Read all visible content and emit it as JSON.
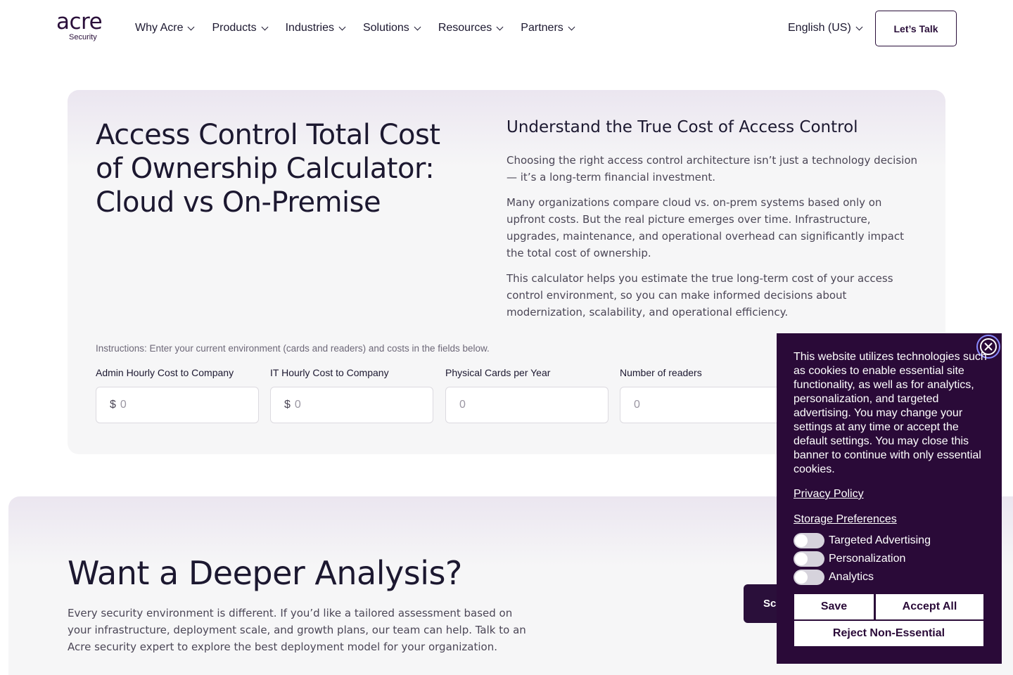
{
  "header": {
    "logo": {
      "word": "acre",
      "sub": "Security"
    },
    "nav": [
      {
        "label": "Why Acre"
      },
      {
        "label": "Products"
      },
      {
        "label": "Industries"
      },
      {
        "label": "Solutions"
      },
      {
        "label": "Resources"
      },
      {
        "label": "Partners"
      }
    ],
    "language": "English (US)",
    "cta": "Let’s Talk"
  },
  "calculator": {
    "title": "Access Control Total Cost of Ownership Calculator: Cloud vs On-Premise",
    "intro_heading": "Understand the True Cost of Access Control",
    "paragraphs": [
      "Choosing the right access control architecture isn’t just a technology decision — it’s a long-term financial investment.",
      "Many organizations compare cloud vs. on-prem systems based only on upfront costs. But the real picture emerges over time. Infrastructure, upgrades, maintenance, and operational overhead can significantly impact the total cost of ownership.",
      "This calculator helps you estimate the true long-term cost of your access control environment, so you can make informed decisions about modernization, scalability, and operational efficiency."
    ],
    "instructions": "Instructions: Enter your current environment (cards and readers) and costs in the fields below.",
    "fields": [
      {
        "label": "Admin Hourly Cost to Company",
        "prefix": "$",
        "placeholder": "0"
      },
      {
        "label": "IT Hourly Cost to Company",
        "prefix": "$",
        "placeholder": "0"
      },
      {
        "label": "Physical Cards per Year",
        "prefix": "",
        "placeholder": "0"
      },
      {
        "label": "Number of readers",
        "prefix": "",
        "placeholder": "0"
      }
    ]
  },
  "analysis": {
    "heading": "Want a Deeper Analysis?",
    "body": "Every security environment is different. If you’d like a tailored assessment based on your infrastructure, deployment scale, and growth plans, our team can help. Talk to an Acre security expert to explore the best deployment model for your organization.",
    "button_visible_text": "Sc"
  },
  "cookie_banner": {
    "text": "This website utilizes technologies such as cookies to enable essential site functionality, as well as for analytics, personalization, and targeted advertising. You may change your settings at any time or accept the default settings. You may close this banner to continue with only essential cookies.",
    "privacy_link": "Privacy Policy",
    "storage_link": "Storage Preferences",
    "toggles": [
      {
        "label": "Targeted Advertising",
        "on": false
      },
      {
        "label": "Personalization",
        "on": false
      },
      {
        "label": "Analytics",
        "on": false
      }
    ],
    "save": "Save",
    "accept_all": "Accept All",
    "reject": "Reject Non-Essential"
  },
  "colors": {
    "brand": "#2a0f3a",
    "banner_bg": "#2a0a38",
    "text": "#1c1830",
    "muted_text": "#4b4656"
  }
}
